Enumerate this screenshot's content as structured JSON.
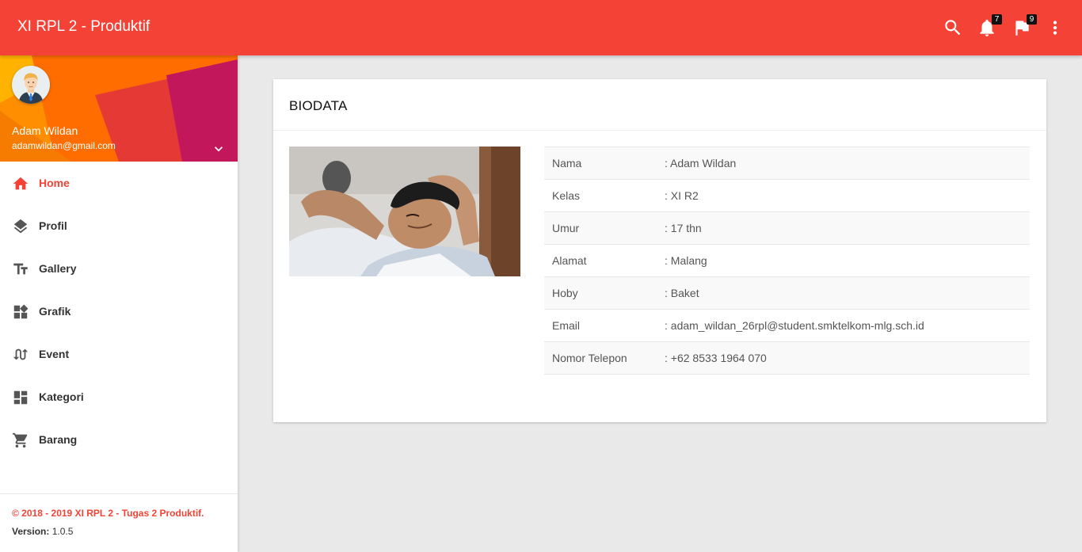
{
  "app": {
    "title": "XI RPL 2 - Produktif"
  },
  "topbar": {
    "icons": [
      {
        "name": "search-icon"
      },
      {
        "name": "notifications-icon",
        "badge": "7"
      },
      {
        "name": "flag-icon",
        "badge": "9"
      },
      {
        "name": "more-vert-icon"
      }
    ]
  },
  "user": {
    "name": "Adam Wildan",
    "email": "adamwildan@gmail.com"
  },
  "menu": {
    "items": [
      {
        "label": "Home",
        "icon": "home-icon",
        "active": true
      },
      {
        "label": "Profil",
        "icon": "layers-icon"
      },
      {
        "label": "Gallery",
        "icon": "text-fields-icon"
      },
      {
        "label": "Grafik",
        "icon": "widgets-icon"
      },
      {
        "label": "Event",
        "icon": "swap-calls-icon"
      },
      {
        "label": "Kategori",
        "icon": "dashboard-icon"
      },
      {
        "label": "Barang",
        "icon": "shopping-cart-icon"
      }
    ]
  },
  "legal": {
    "copyright": "© 2018 - 2019 XI RPL 2 - Tugas 2 Produktif.",
    "version_label": "Version:",
    "version_value": "1.0.5"
  },
  "card": {
    "title": "BIODATA",
    "rows": [
      {
        "key": "Nama",
        "value": ": Adam Wildan"
      },
      {
        "key": "Kelas",
        "value": ": XI R2"
      },
      {
        "key": "Umur",
        "value": ": 17 thn"
      },
      {
        "key": "Alamat",
        "value": ": Malang"
      },
      {
        "key": "Hoby",
        "value": ": Baket"
      },
      {
        "key": "Email",
        "value": ": adam_wildan_26rpl@student.smktelkom-mlg.sch.id"
      },
      {
        "key": "Nomor Telepon",
        "value": ": +62 8533 1964 070"
      }
    ]
  },
  "colors": {
    "primary": "#f44336",
    "background": "#e9e9e9",
    "sidebar_header": "#ff7a00"
  }
}
